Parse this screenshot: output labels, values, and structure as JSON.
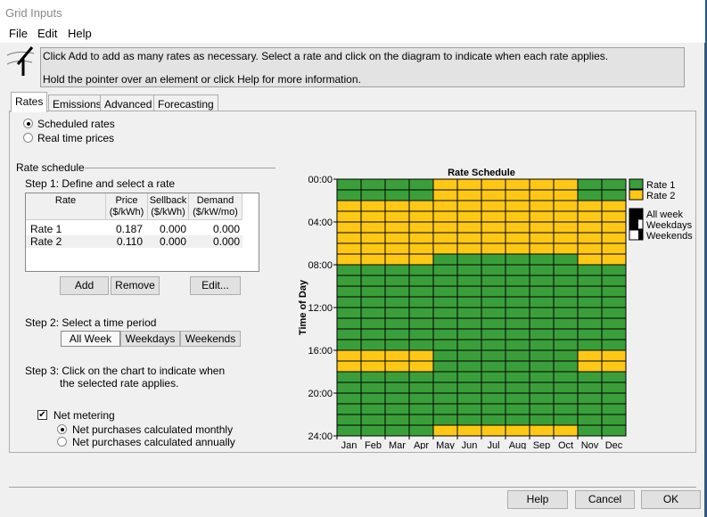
{
  "window": {
    "title": "Grid Inputs"
  },
  "menu": [
    "File",
    "Edit",
    "Help"
  ],
  "info": {
    "line1": "Click Add to add as many rates as necessary.  Select a rate and click on the diagram to indicate when each rate applies.",
    "line2": "Hold the pointer over an element or click Help for more information."
  },
  "tabs": [
    "Rates",
    "Emissions",
    "Advanced",
    "Forecasting"
  ],
  "rate_type": {
    "options": [
      "Scheduled rates",
      "Real time prices"
    ],
    "selected": 0
  },
  "rate_schedule": {
    "label": "Rate schedule",
    "step1": "Step 1:  Define and select a rate",
    "columns": [
      {
        "l1": "Rate",
        "l2": ""
      },
      {
        "l1": "Price",
        "l2": "($/kWh)"
      },
      {
        "l1": "Sellback",
        "l2": "($/kWh)"
      },
      {
        "l1": "Demand",
        "l2": "($/kW/mo)"
      }
    ],
    "rows": [
      [
        "Rate 1",
        "0.187",
        "0.000",
        "0.000"
      ],
      [
        "Rate 2",
        "0.110",
        "0.000",
        "0.000"
      ]
    ],
    "buttons": {
      "add": "Add",
      "remove": "Remove",
      "edit": "Edit..."
    },
    "step2": "Step 2:  Select a time period",
    "periods": [
      "All Week",
      "Weekdays",
      "Weekends"
    ],
    "period_selected": 0,
    "step3a": "Step 3:  Click on the chart to indicate when",
    "step3b": "the selected rate applies."
  },
  "net_metering": {
    "label": "Net metering",
    "checked": true,
    "options": [
      "Net purchases calculated monthly",
      "Net purchases calculated annually"
    ],
    "selected": 0
  },
  "footer": {
    "help": "Help",
    "cancel": "Cancel",
    "ok": "OK"
  },
  "chart_data": {
    "type": "heatmap",
    "title": "Rate Schedule",
    "ylabel": "Time of Day",
    "xlabels": [
      "Jan",
      "Feb",
      "Mar",
      "Apr",
      "May",
      "Jun",
      "Jul",
      "Aug",
      "Sep",
      "Oct",
      "Nov",
      "Dec"
    ],
    "yticks": [
      "00:00",
      "04:00",
      "08:00",
      "12:00",
      "16:00",
      "20:00",
      "24:00"
    ],
    "colors": {
      "1": "#3a9f3a",
      "2": "#ffc814"
    },
    "legend": [
      {
        "label": "Rate 1",
        "rate": 1
      },
      {
        "label": "Rate 2",
        "rate": 2
      }
    ],
    "period_legend": [
      "All week",
      "Weekdays",
      "Weekends"
    ],
    "winter_profile": [
      1,
      1,
      2,
      2,
      2,
      2,
      2,
      2,
      1,
      1,
      1,
      1,
      1,
      1,
      1,
      1,
      2,
      2,
      1,
      1,
      1,
      1,
      1,
      1
    ],
    "summer_profile": [
      2,
      2,
      2,
      2,
      2,
      2,
      2,
      1,
      1,
      1,
      1,
      1,
      1,
      1,
      1,
      1,
      1,
      1,
      1,
      1,
      1,
      1,
      1,
      2
    ],
    "month_profile": [
      "winter",
      "winter",
      "winter",
      "winter",
      "summer",
      "summer",
      "summer",
      "summer",
      "summer",
      "summer",
      "winter",
      "winter"
    ]
  }
}
